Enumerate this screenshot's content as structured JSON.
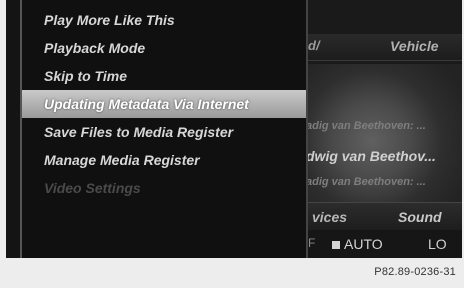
{
  "menu": {
    "items": [
      {
        "label": "Play More Like This"
      },
      {
        "label": "Playback Mode"
      },
      {
        "label": "Skip to Time"
      },
      {
        "label": "Updating Metadata Via Internet"
      },
      {
        "label": "Save Files to Media Register"
      },
      {
        "label": "Manage Media Register"
      },
      {
        "label": "Video Settings"
      }
    ]
  },
  "background": {
    "top_left": "d/",
    "top_right": "Vehicle",
    "tracks": [
      "adig van Beethoven: ...",
      "dwig van Beethov...",
      "adig van Beethoven: ..."
    ],
    "bottom_left": "vices",
    "bottom_right": "Sound",
    "status_left": "F",
    "status_auto": "AUTO",
    "status_right": "LO"
  },
  "caption": "P82.89-0236-31"
}
